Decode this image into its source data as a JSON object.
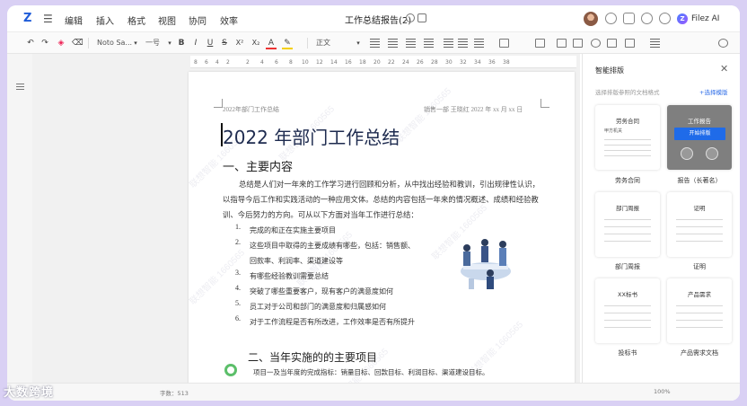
{
  "menubar": {
    "items": [
      "编辑",
      "插入",
      "格式",
      "视图",
      "协同",
      "效率"
    ],
    "doc_title": "工作总结报告(2)",
    "ai_label": "Filez AI"
  },
  "toolbar": {
    "font_name": "Noto Sa...",
    "font_size": "一号",
    "bold": "B",
    "italic": "I",
    "underline": "U",
    "strike": "S",
    "superscript": "X²",
    "subscript": "X₂",
    "font_color": "A",
    "style": "正文"
  },
  "ruler": {
    "ticks": [
      "8",
      "6",
      "4",
      "2",
      "2",
      "4",
      "6",
      "8",
      "10",
      "12",
      "14",
      "16",
      "18",
      "20",
      "22",
      "24",
      "26",
      "28",
      "30",
      "32",
      "34",
      "36",
      "38"
    ]
  },
  "document": {
    "header_left": "2022年部门工作总结",
    "header_right": "销售一部  王晓红  2022 年 xx 月 xx 日",
    "title": "2022 年部门工作总结",
    "section1": "一、主要内容",
    "paragraph": "总结是人们对一年来的工作学习进行回顾和分析，从中找出经验和教训，引出规律性认识，以指导今后工作和实践活动的一种应用文体。总结的内容包括一年来的情况概述、成绩和经验教训、今后努力的方向。可从以下方面对当年工作进行总结：",
    "list": [
      {
        "n": "1.",
        "t": "完成的和正在实施主要项目"
      },
      {
        "n": "2.",
        "t": "这些项目中取得的主要成绩有哪些，包括：销售额、回款率、利润率、渠道建设等"
      },
      {
        "n": "3.",
        "t": "有哪些经验教训需要总结"
      },
      {
        "n": "4.",
        "t": "突破了哪些重要客户，现有客户的满意度如何"
      },
      {
        "n": "5.",
        "t": "员工对于公司和部门的满意度和归属感如何"
      },
      {
        "n": "6.",
        "t": "对于工作流程是否有所改进，工作效率是否有所提升"
      }
    ],
    "section2": "二、当年实施的的主要项目",
    "section2_line": "项目一及当年度的完成指标：销量目标、回款目标、利润目标、渠道建设目标。",
    "watermark": "联想智能 1660565"
  },
  "panel": {
    "title": "智能排版",
    "subtitle": "选择排版参照的文档格式",
    "link": "+选择模版",
    "apply_label": "开始排版",
    "cards": [
      {
        "title": "劳务合同",
        "sub": "甲方机关",
        "label": "劳务合同"
      },
      {
        "title": "工作报告",
        "sub": "",
        "label": "报告（长著名）"
      },
      {
        "title": "部门周报",
        "sub": "",
        "label": "部门周报"
      },
      {
        "title": "证明",
        "sub": "",
        "label": "证明"
      },
      {
        "title": "XX标书",
        "sub": "",
        "label": "投标书"
      },
      {
        "title": "产品需求",
        "sub": "",
        "label": "产品需求文档"
      }
    ]
  },
  "statusbar": {
    "left": "字数：513",
    "zoom": "100%"
  },
  "brand": "大数跨境"
}
